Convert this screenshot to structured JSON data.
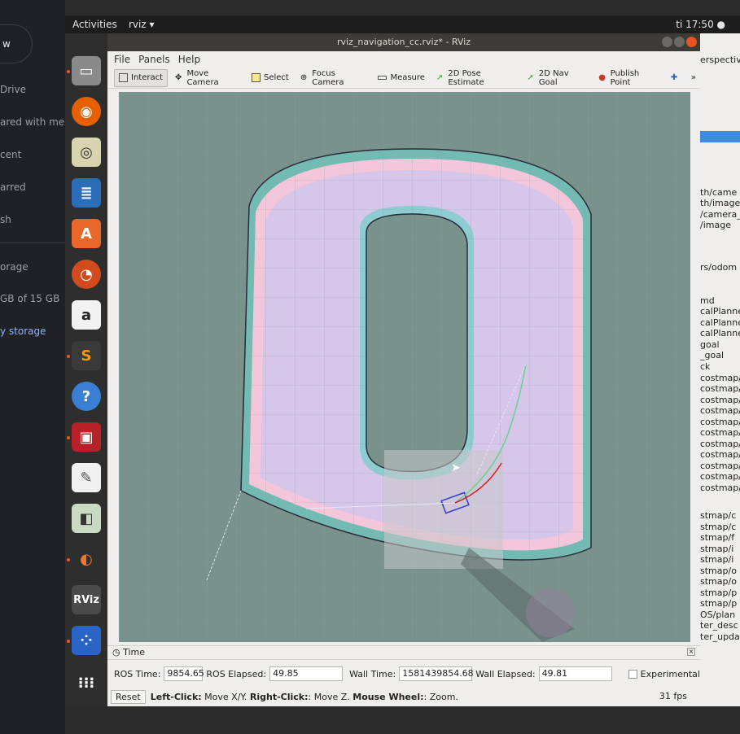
{
  "background_app": {
    "new_label": "w",
    "items": [
      "Drive",
      "ared with me",
      "cent",
      "arred",
      "sh"
    ],
    "storage_label": "orage",
    "storage_usage": "GB of 15 GB",
    "buy_storage": "y storage"
  },
  "topbar": {
    "activities": "Activities",
    "app": "rviz ▾",
    "clock": "ti 17:50 ●"
  },
  "dock": {
    "icons": [
      "files-icon",
      "firefox-icon",
      "rhythmbox-icon",
      "writer-icon",
      "software-icon",
      "impress-icon",
      "amazon-icon",
      "sublime-icon",
      "help-icon",
      "terminal-icon",
      "text-editor-icon",
      "image-viewer-icon",
      "blender-icon",
      "rviz-icon",
      "grid-icon",
      "show-apps-icon"
    ],
    "glyphs": [
      "▭",
      "◉",
      "◎",
      "≣",
      "A",
      "◔",
      "a",
      "S",
      "?",
      "▣",
      "✎",
      "◧",
      "◐",
      "RViz",
      "⁘",
      "⁝⁝⁝"
    ]
  },
  "window": {
    "title": "rviz_navigation_cc.rviz* - RViz",
    "menu": [
      "File",
      "Panels",
      "Help"
    ],
    "toolbar": [
      "Interact",
      "Move Camera",
      "Select",
      "Focus Camera",
      "Measure",
      "2D Pose Estimate",
      "2D Nav Goal",
      "Publish Point",
      "»"
    ]
  },
  "time_panel": {
    "title": "Time",
    "ros_time_label": "ROS Time:",
    "ros_time": "9854.65",
    "ros_elapsed_label": "ROS Elapsed:",
    "ros_elapsed": "49.85",
    "wall_time_label": "Wall Time:",
    "wall_time": "1581439854.68",
    "wall_elapsed_label": "Wall Elapsed:",
    "wall_elapsed": "49.81",
    "experimental": "Experimental",
    "reset": "Reset",
    "hint_left": "Left-Click:",
    "hint_left_text": "Move X/Y.",
    "hint_right": "Right-Click:",
    "hint_right_text": ": Move Z.",
    "hint_wheel": "Mouse Wheel:",
    "hint_wheel_text": ": Zoom.",
    "fps": "31 fps"
  },
  "right_panel": {
    "header": "erspectiv",
    "lines": [
      "th/came",
      "th/image",
      "/camera_",
      "/image",
      "rs/odom",
      "md",
      "calPlanne",
      "calPlanne",
      "calPlanne",
      "goal",
      "_goal",
      "ck",
      "costmap/",
      "costmap/",
      "costmap/",
      "costmap/",
      "costmap/",
      "costmap/",
      "costmap/",
      "costmap/",
      "costmap/",
      "costmap/",
      "costmap/",
      "stmap/c",
      "stmap/c",
      "stmap/f",
      "stmap/i",
      "stmap/i",
      "stmap/o",
      "stmap/o",
      "stmap/p",
      "stmap/p",
      "OS/plan",
      "ter_desc",
      "ter_upda"
    ]
  }
}
